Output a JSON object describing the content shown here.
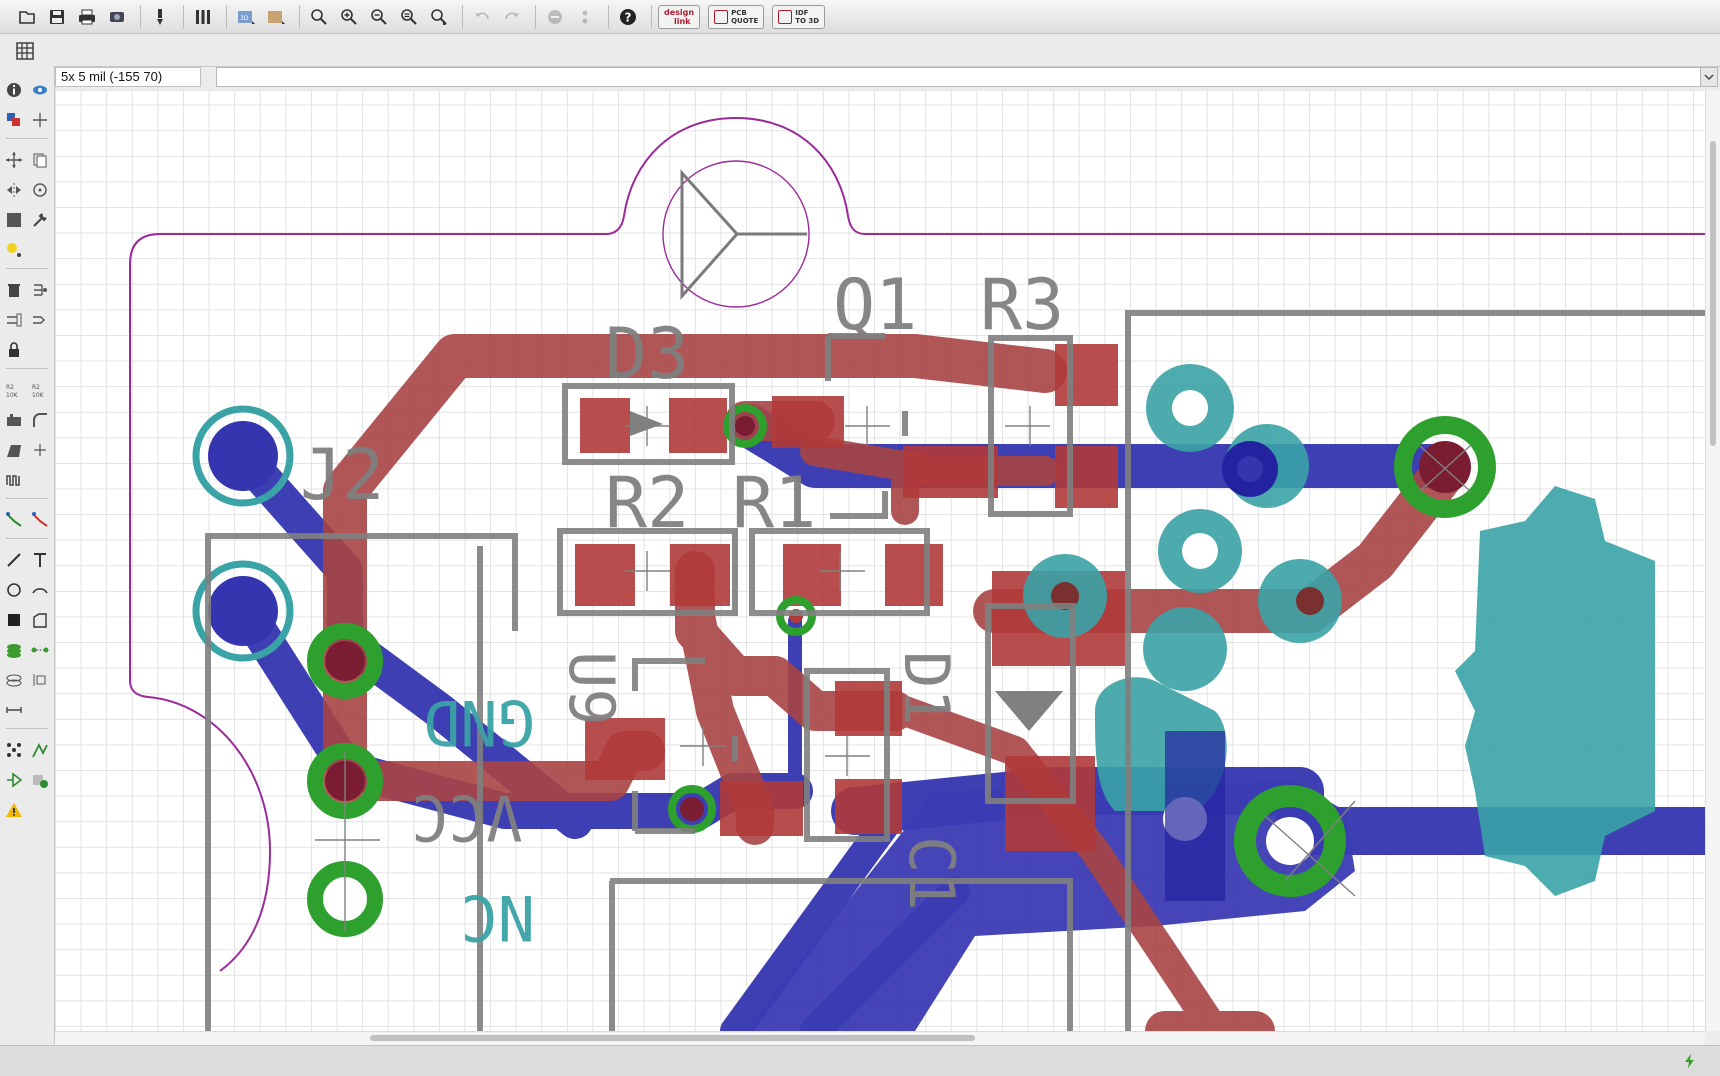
{
  "toolbar": {
    "items": [
      {
        "name": "open-icon"
      },
      {
        "name": "save-icon"
      },
      {
        "name": "print-icon"
      },
      {
        "name": "cam-processor-icon"
      },
      {
        "name": "ulp-icon"
      },
      {
        "name": "layer-settings-icon"
      },
      {
        "name": "3d-view-icon"
      },
      {
        "name": "board-preview-icon"
      },
      {
        "name": "zoom-fit-icon"
      },
      {
        "name": "zoom-in-icon"
      },
      {
        "name": "zoom-out-icon"
      },
      {
        "name": "zoom-redraw-icon"
      },
      {
        "name": "zoom-select-icon"
      },
      {
        "name": "undo-icon"
      },
      {
        "name": "redo-icon"
      },
      {
        "name": "stop-icon"
      },
      {
        "name": "go-icon"
      },
      {
        "name": "help-icon"
      }
    ],
    "design_link": {
      "line1": "design",
      "line2": "link"
    },
    "pcb_quote": {
      "line1": "PCB",
      "line2": "QUOTE"
    },
    "idf_3d": {
      "line1": "IDF",
      "line2": "TO 3D"
    }
  },
  "coordinates": {
    "display": "5x 5 mil (-155 70)"
  },
  "command_line": {
    "value": ""
  },
  "board": {
    "labels": {
      "q1": "Q1",
      "r3": "R3",
      "d3": "D3",
      "j2": "J2",
      "r2": "R2",
      "r1": "R1",
      "gnd": "GND",
      "u9": "U9",
      "d1": "D1",
      "vcc": "VCC",
      "c1": "C1",
      "nc": "NC"
    },
    "colors": {
      "top_copper": "#b03a3a",
      "bottom_copper": "#2b2b9e",
      "via_ring": "#2ea02e",
      "pad_ring": "#2b9aa0",
      "silkscreen": "#7a7a7a",
      "dimension": "#9b2a9b",
      "grid": "#e2e2e2"
    }
  },
  "status": {
    "text": ""
  }
}
